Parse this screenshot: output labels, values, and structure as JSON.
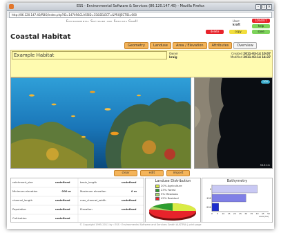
{
  "window": {
    "title": "ESS - Environmental Software & Services (86.120.147.40) - Mozilla Firefox",
    "url": "http://86.120.147.40/RBO/index.php?ID=14749&CLASSID=15&SELECT=&PROJECTID=600"
  },
  "brand": "Environmental Software and Services GmbH",
  "user": {
    "label": "User:",
    "name": "kraft",
    "buttons": {
      "logout": "LOGOUT",
      "help": "help",
      "delete": "delete",
      "copy": "copy",
      "save": "save"
    }
  },
  "page_title": "Coastal Habitat",
  "tabs": [
    "Geometry",
    "Landuse",
    "Area / Elevation",
    "Attributes",
    "Overview"
  ],
  "habitat": {
    "name": "Example Habitat",
    "owner_label": "Owner",
    "owner": "kraig",
    "created_label": "Created",
    "created": "2011-03-14 10:07",
    "modified_label": "Modified",
    "modified": "2011-03-14 14:37"
  },
  "map": {
    "button": "100",
    "scale": "56.8 km"
  },
  "actions": [
    "clear",
    "edit",
    "import"
  ],
  "stats": {
    "rows": [
      [
        {
          "k": "catchment_size",
          "v": "undefined"
        },
        {
          "k": "basin_length",
          "v": "undefined"
        }
      ],
      [
        {
          "k": "Minimum elevation",
          "v": "-200 m"
        },
        {
          "k": "Maximum elevation",
          "v": "0 m"
        }
      ],
      [
        {
          "k": "channel_length",
          "v": "undefined"
        },
        {
          "k": "max_channel_width",
          "v": "undefined"
        }
      ],
      [
        {
          "k": "Population",
          "v": "undefined"
        },
        {
          "k": "Elevation",
          "v": "undefined"
        }
      ],
      [
        {
          "k": "Cultivation",
          "v": "undefined"
        },
        {
          "k": "",
          "v": ""
        }
      ]
    ]
  },
  "landuse": {
    "title": "Landuse Distribution",
    "items": [
      {
        "label": "20% Agriculture",
        "color": "#d9ec45"
      },
      {
        "label": "23% Forest",
        "color": "#2d9d2f"
      },
      {
        "label": "5% Meadows",
        "color": "#a6d96a"
      },
      {
        "label": "42% Residual",
        "color": "#e8232b"
      }
    ]
  },
  "chart_data": {
    "type": "bar",
    "title": "Bathymetry",
    "orientation": "horizontal",
    "categories": [
      "0",
      "-100",
      "-200"
    ],
    "values": [
      40,
      30,
      6
    ],
    "xticks": [
      "0",
      "5",
      "10",
      "15",
      "20",
      "25",
      "30",
      "35",
      "40",
      "45",
      "50"
    ],
    "xlabel": "area (ha)",
    "xlim": [
      0,
      50
    ],
    "colors": [
      "#c9c9f4",
      "#7f7fe6",
      "#1c2ccf"
    ]
  },
  "footer": "© Copyright 1995-2011 by : ESS · Environmental Software and Services GmbH AUSTRIA | print page"
}
